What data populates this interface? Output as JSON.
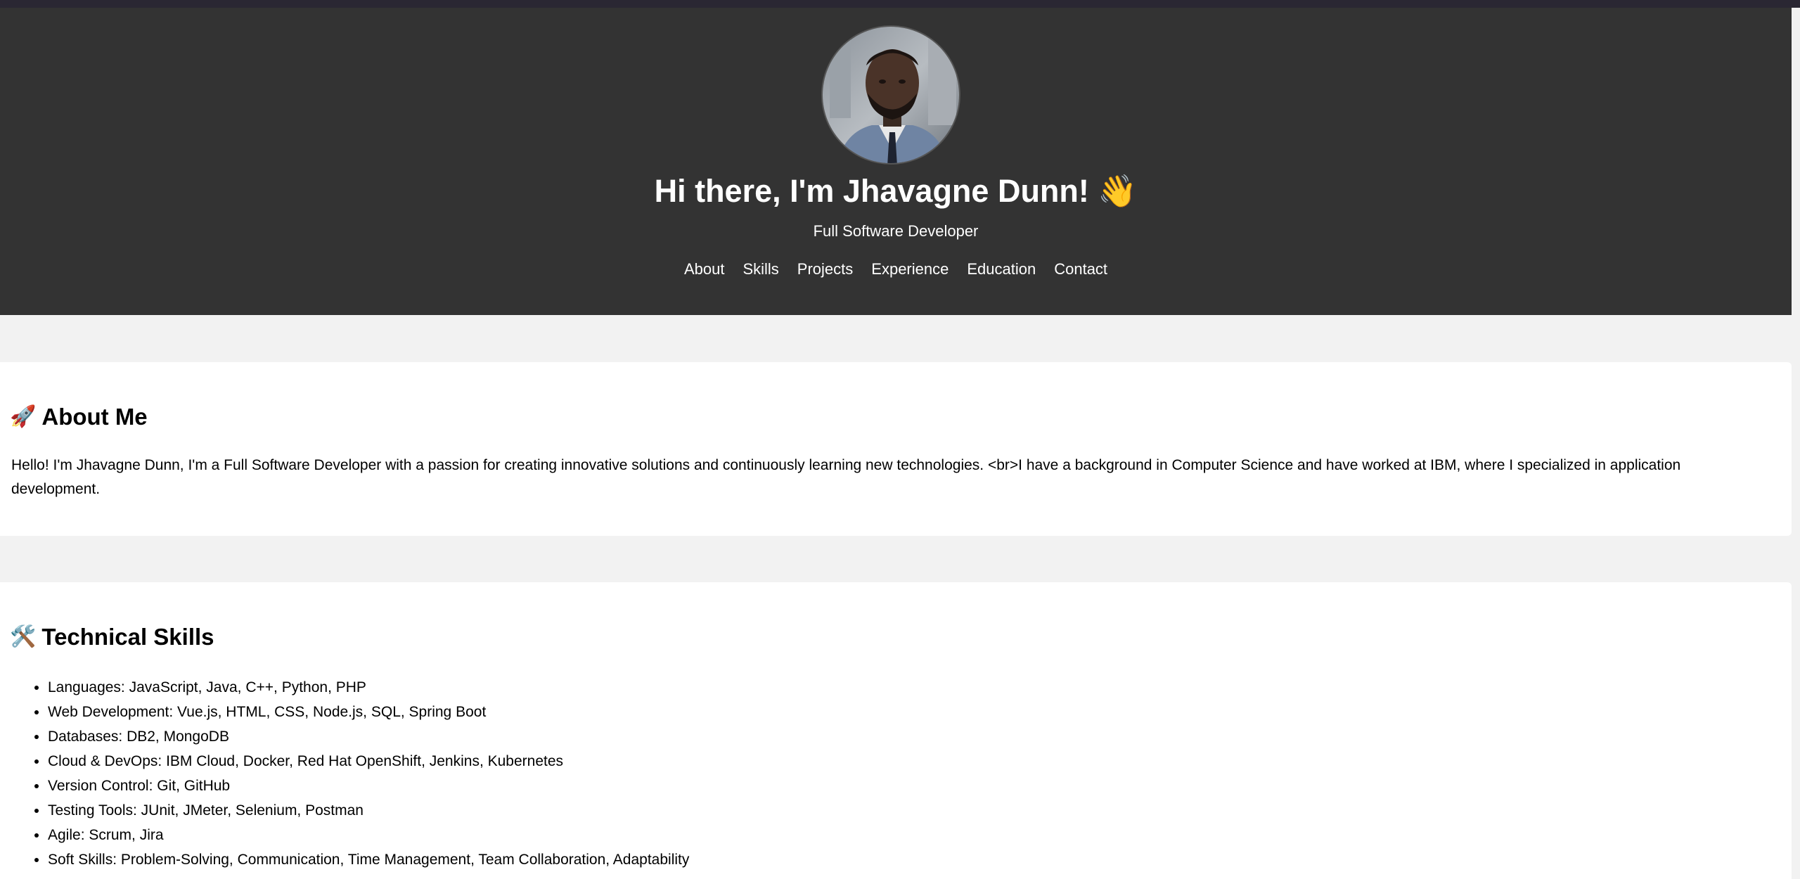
{
  "header": {
    "title": "Hi there, I'm Jhavagne Dunn! 👋",
    "subtitle": "Full Software Developer",
    "avatar_alt": "profile photo"
  },
  "nav": {
    "items": [
      {
        "label": "About"
      },
      {
        "label": "Skills"
      },
      {
        "label": "Projects"
      },
      {
        "label": "Experience"
      },
      {
        "label": "Education"
      },
      {
        "label": "Contact"
      }
    ]
  },
  "about": {
    "emoji": "🚀",
    "heading": "About Me",
    "text": "Hello! I'm Jhavagne Dunn, I'm a Full Software Developer with a passion for creating innovative solutions and continuously learning new technologies. <br>I have a background in Computer Science and have worked at IBM, where I specialized in application development."
  },
  "skills": {
    "emoji": "🛠️",
    "heading": "Technical Skills",
    "items": [
      "Languages: JavaScript, Java, C++, Python, PHP",
      "Web Development: Vue.js, HTML, CSS, Node.js, SQL, Spring Boot",
      "Databases: DB2, MongoDB",
      "Cloud & DevOps: IBM Cloud, Docker, Red Hat OpenShift, Jenkins, Kubernetes",
      "Version Control: Git, GitHub",
      "Testing Tools: JUnit, JMeter, Selenium, Postman",
      "Agile: Scrum, Jira",
      "Soft Skills: Problem-Solving, Communication, Time Management, Team Collaboration, Adaptability"
    ]
  },
  "colors": {
    "header_bg": "#333333",
    "page_bg": "#f2f2f2",
    "card_bg": "#ffffff",
    "header_text": "#ffffff"
  }
}
